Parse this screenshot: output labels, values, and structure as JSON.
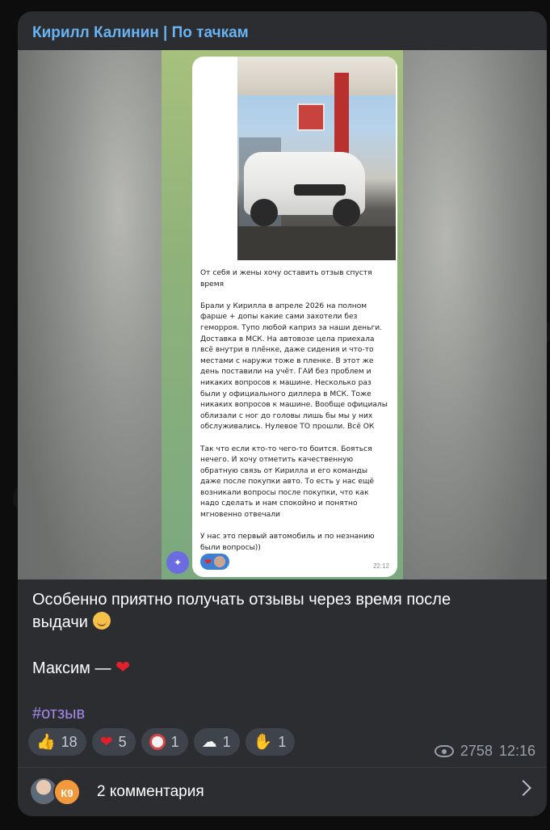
{
  "post": {
    "channel_title": "Кирилл Калинин | По тачкам",
    "caption_line1": "Особенно приятно получать отзывы через время после",
    "caption_line2": "выдачи",
    "signature": "Максим —",
    "hashtag": "#отзыв"
  },
  "screenshot": {
    "review_paragraphs": [
      "От себя и жены хочу оставить отзыв спустя время",
      "Брали у Кирилла в апреле 2026 на полном фарше + допы какие сами захотели без геморроя. Тупо любой каприз за наши деньги. Доставка в МСК. На автовозе цела приехала всё внутри в плёнке, даже сидения и что-то местами с наружи тоже в пленке. В этот же день поставили на учёт. ГАИ без проблем и никаких вопросов к машине. Несколько раз были у официального диллера в МСК. Тоже никаких вопросов к машине. Вообще официалы облизали с ног до головы лишь бы мы у них обслуживались. Нулевое ТО прошли. Всё ОК",
      "Так что если кто-то чего-то боится. Бояться нечего. И хочу отметить качественную обратную связь от Кирилла и его команды даже после покупки авто. То есть у нас ещё возникали вопросы после покупки, что как надо сделать и нам спокойно и понятно мгновенно отвечали",
      "У нас это первый автомобиль и по незнанию были вопросы))"
    ],
    "time": "22:12"
  },
  "reactions": [
    {
      "icon": "thumbs-up-icon",
      "count": "18"
    },
    {
      "icon": "heart-icon",
      "count": "5"
    },
    {
      "icon": "clown-icon",
      "count": "1"
    },
    {
      "icon": "ghost-icon",
      "count": "1"
    },
    {
      "icon": "handshake-icon",
      "count": "1"
    }
  ],
  "meta": {
    "views": "2758",
    "time": "12:16"
  },
  "comments": {
    "avatar_initials": "К9",
    "label": "2 комментария"
  },
  "colors": {
    "accent": "#6ab3f3",
    "bubble": "#2c2d31",
    "hashtag": "#a589e9"
  }
}
